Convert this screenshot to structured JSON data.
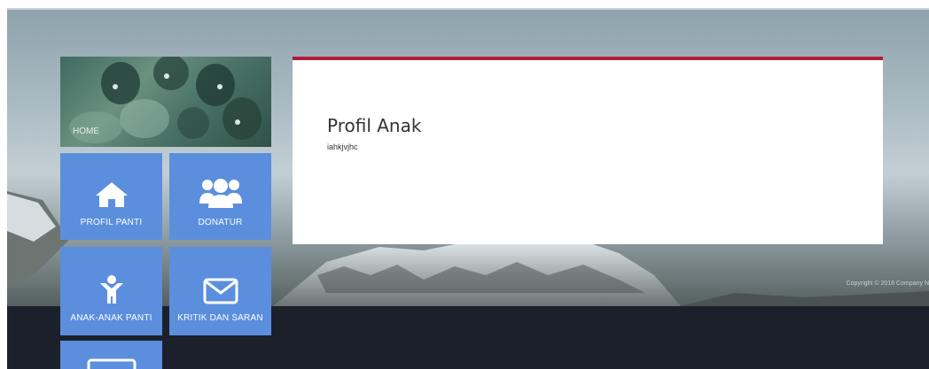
{
  "nav": {
    "home_label": "HOME",
    "profil_panti_label": "PROFIL PANTI",
    "donatur_label": "DONATUR",
    "anak_anak_panti_label": "ANAK-ANAK PANTI",
    "kritik_dan_saran_label": "KRITIK DAN SARAN"
  },
  "content": {
    "title": "Profil Anak",
    "body": "iahkjvjhc"
  },
  "footer": {
    "copyright": "Copyright © 2016 Company N"
  },
  "colors": {
    "tile": "#5b8fdd",
    "panel_accent": "#b21c3e",
    "footer": "#1c202b"
  },
  "icons": [
    "home-icon",
    "users-icon",
    "child-icon",
    "envelope-icon",
    "id-card-icon"
  ]
}
